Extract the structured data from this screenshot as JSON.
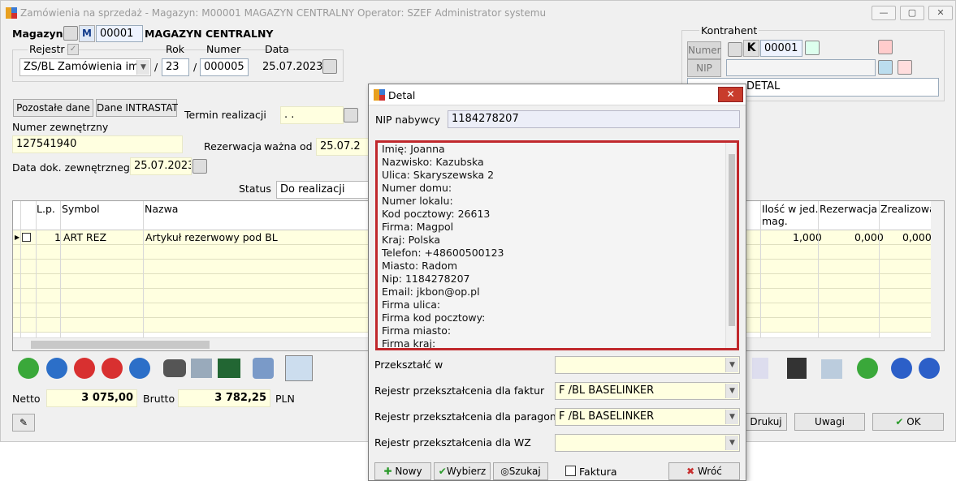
{
  "window": {
    "title": "Zamówienia na sprzedaż - Magazyn: M00001 MAGAZYN CENTRALNY  Operator: SZEF Administrator systemu"
  },
  "header": {
    "magazyn_label": "Magazyn",
    "magazyn_m": "M",
    "magazyn_code": "00001",
    "magazyn_name": "MAGAZYN CENTRALNY",
    "rejestr_label": "Rejestr",
    "rok_label": "Rok",
    "numer_label": "Numer",
    "data_label": "Data",
    "rejestr_value": "ZS/BL Zamówienia imp",
    "slash": "/",
    "rok_value": "23",
    "numer_value": "000005",
    "data_value": "25.07.2023"
  },
  "buttons": {
    "pozostale": "Pozostałe dane",
    "intrastat": "Dane INTRASTAT",
    "termin_label": "Termin realizacji",
    "termin_value": ". .",
    "numer_zew_label": "Numer zewnętrzny",
    "numer_zew_value": "127541940",
    "rezerwacja_label": "Rezerwacja",
    "wazna_od_label": "ważna od",
    "wazna_od_value": "25.07.2",
    "data_dok_label": "Data dok. zewnętrznego",
    "data_dok_value": "25.07.2023",
    "status_label": "Status",
    "status_value": "Do realizacji"
  },
  "kontrahent": {
    "group": "Kontrahent",
    "numer_label": "Numer",
    "k": "K",
    "numer_value": "00001",
    "nip_label": "NIP",
    "name_value": "DETAL"
  },
  "grid": {
    "headers": {
      "lp": "L.p.",
      "symbol": "Symbol",
      "nazwa": "Nazwa",
      "ilosc": "Ilość w jed.",
      "ilosc2": "mag.",
      "rez": "Rezerwacja",
      "zreal": "Zrealizowa"
    },
    "row": {
      "lp": "1",
      "symbol": "ART REZ",
      "nazwa": "Artykuł rezerwowy pod BL",
      "ilosc": "1,000",
      "rez": "0,000",
      "zreal": "0,000"
    }
  },
  "totals": {
    "netto_label": "Netto",
    "netto": "3 075,00",
    "brutto_label": "Brutto",
    "brutto": "3 782,25",
    "currency": "PLN"
  },
  "footer": {
    "drukuj": "Drukuj",
    "uwagi": "Uwagi",
    "ok": "OK"
  },
  "dialog": {
    "title": "Detal",
    "nip_label": "NIP nabywcy",
    "nip_value": "1184278207",
    "memo": [
      "Imię: Joanna",
      "Nazwisko: Kazubska",
      "Ulica: Skaryszewska 2",
      "Numer domu:",
      "Numer lokalu:",
      "Kod pocztowy: 26613",
      "Firma: Magpol",
      "Kraj: Polska",
      "Telefon: +48600500123",
      "Miasto: Radom",
      "Nip: 1184278207",
      "Email: jkbon@op.pl",
      "Firma ulica:",
      "Firma kod pocztowy:",
      "Firma miasto:",
      "Firma kraj:"
    ],
    "przeksztalc_label": "Przekształć w",
    "przeksztalc_value": "",
    "rej_faktur_label": "Rejestr przekształcenia dla faktur",
    "rej_faktur_value": "F /BL BASELINKER",
    "rej_paragonu_label": "Rejestr przekształcenia dla paragonu",
    "rej_paragonu_value": "F /BL BASELINKER",
    "rej_wz_label": "Rejestr przekształcenia dla WZ",
    "rej_wz_value": "",
    "nowy": "Nowy",
    "wybierz": "Wybierz",
    "szukaj": "Szukaj",
    "faktura": "Faktura",
    "wroc": "Wróć"
  }
}
